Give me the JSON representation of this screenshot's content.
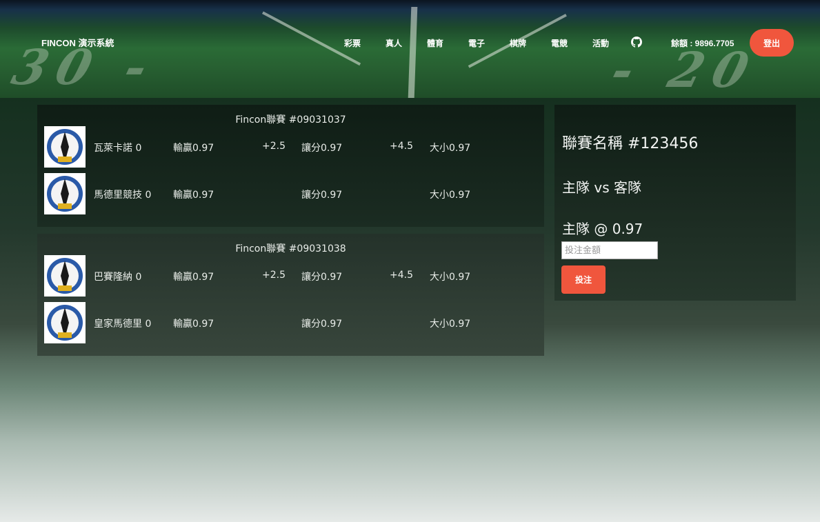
{
  "header": {
    "brand": "FINCON 演示系統",
    "nav": [
      "彩票",
      "真人",
      "體育",
      "電子",
      "棋牌",
      "電競",
      "活動"
    ],
    "github_icon": "github-icon",
    "balance_label": "餘額 : 9896.7705",
    "logout_label": "登出",
    "accent_color": "#f0563d"
  },
  "matches": [
    {
      "league": "Fincon聯賽 #09031037",
      "teams": [
        {
          "name": "瓦萊卡諾 0",
          "moneyline": "輸贏0.97",
          "handicap_line": "+2.5",
          "handicap": "讓分0.97",
          "total_line": "+4.5",
          "total": "大小0.97"
        },
        {
          "name": "馬德里競技 0",
          "moneyline": "輸贏0.97",
          "handicap_line": "",
          "handicap": "讓分0.97",
          "total_line": "",
          "total": "大小0.97"
        }
      ]
    },
    {
      "league": "Fincon聯賽 #09031038",
      "teams": [
        {
          "name": "巴賽隆納 0",
          "moneyline": "輸贏0.97",
          "handicap_line": "+2.5",
          "handicap": "讓分0.97",
          "total_line": "+4.5",
          "total": "大小0.97"
        },
        {
          "name": "皇家馬德里 0",
          "moneyline": "輸贏0.97",
          "handicap_line": "",
          "handicap": "讓分0.97",
          "total_line": "",
          "total": "大小0.97"
        }
      ]
    }
  ],
  "bet_slip": {
    "league": "聯賽名稱 #123456",
    "match": "主隊 vs 客隊",
    "pick": "主隊 @ 0.97",
    "amount_placeholder": "投注金額",
    "amount_value": "",
    "submit_label": "投注"
  }
}
